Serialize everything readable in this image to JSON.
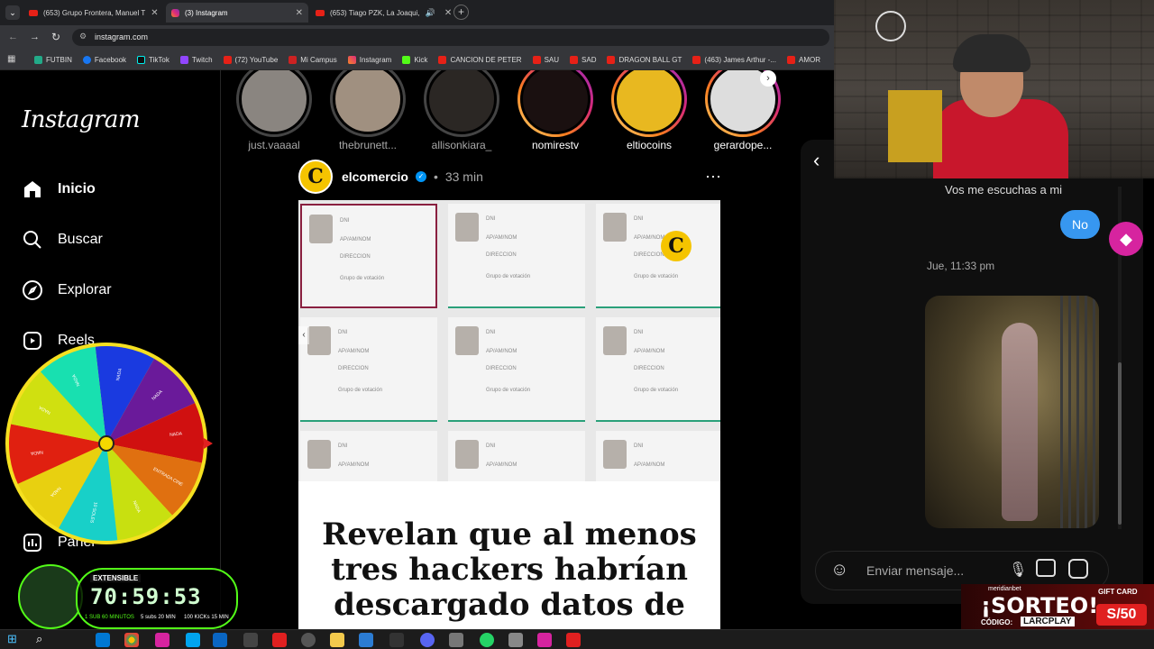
{
  "browser": {
    "tabs": [
      {
        "title": "(653) Grupo Frontera, Manuel T",
        "icon": "youtube-icon",
        "active": false
      },
      {
        "title": "(3) Instagram",
        "icon": "instagram-icon",
        "active": true
      },
      {
        "title": "(653) Tiago PZK, La Joaqui,",
        "icon": "youtube-icon",
        "active": false
      }
    ],
    "url": "instagram.com",
    "bookmarks": [
      "FUTBIN",
      "Facebook",
      "TikTok",
      "Twitch",
      "(72) YouTube",
      "Mi Campus",
      "Instagram",
      "Kick",
      "CANCION DE PETER",
      "SAU",
      "SAD",
      "DRAGON BALL GT",
      "(463) James Arthur -...",
      "AMOR"
    ]
  },
  "sidebar": {
    "logo": "Instagram",
    "items": [
      {
        "label": "Inicio",
        "icon": "home-icon"
      },
      {
        "label": "Buscar",
        "icon": "search-icon"
      },
      {
        "label": "Explorar",
        "icon": "compass-icon"
      },
      {
        "label": "Reels",
        "icon": "reels-icon"
      },
      {
        "label": "Panel",
        "icon": "dashboard-icon"
      }
    ]
  },
  "stories": [
    "just.vaaaal",
    "thebrunett...",
    "allisonkiara_",
    "nomirestv",
    "eltiocoins",
    "gerardope..."
  ],
  "post": {
    "username": "elcomercio",
    "time": "33 min",
    "headline": "Revelan que al menos tres hackers habrían descargado datos de",
    "card_labels": {
      "dni": "DNI",
      "name": "AP/AM/NOM",
      "address": "DIRECCION",
      "vote": "Grupo de votación"
    }
  },
  "chat": {
    "prev_message": "Vos me escuchas a mi",
    "sent_message": "No",
    "timestamp": "Jue, 11:33 pm",
    "input_placeholder": "Enviar mensaje..."
  },
  "overlays": {
    "wheel_labels": [
      "NADA",
      "NADA",
      "NADA",
      "ENTRADA CINE",
      "NADA",
      "10 SOLES",
      "NADA",
      "NADA",
      "NADA",
      "NADA"
    ],
    "timer": "70:59:53",
    "timer_badge": "EXTENSIBLE",
    "timer_sub": [
      "1 SUB 60 MINUTOS",
      "5 subs 20 MIN",
      "100 KICKs 15 MIN"
    ],
    "promo_brand": "meridianbet",
    "promo_title": "¡SORTEO!",
    "promo_code_label": "CÓDIGO:",
    "promo_code": "LARCPLAY",
    "gift_card_label": "GIFT CARD",
    "gift_card_value": "S/50"
  },
  "colors": {
    "accent": "#0095f6",
    "instagram_bg": "#000000",
    "chat_bubble": "#3797f0"
  }
}
